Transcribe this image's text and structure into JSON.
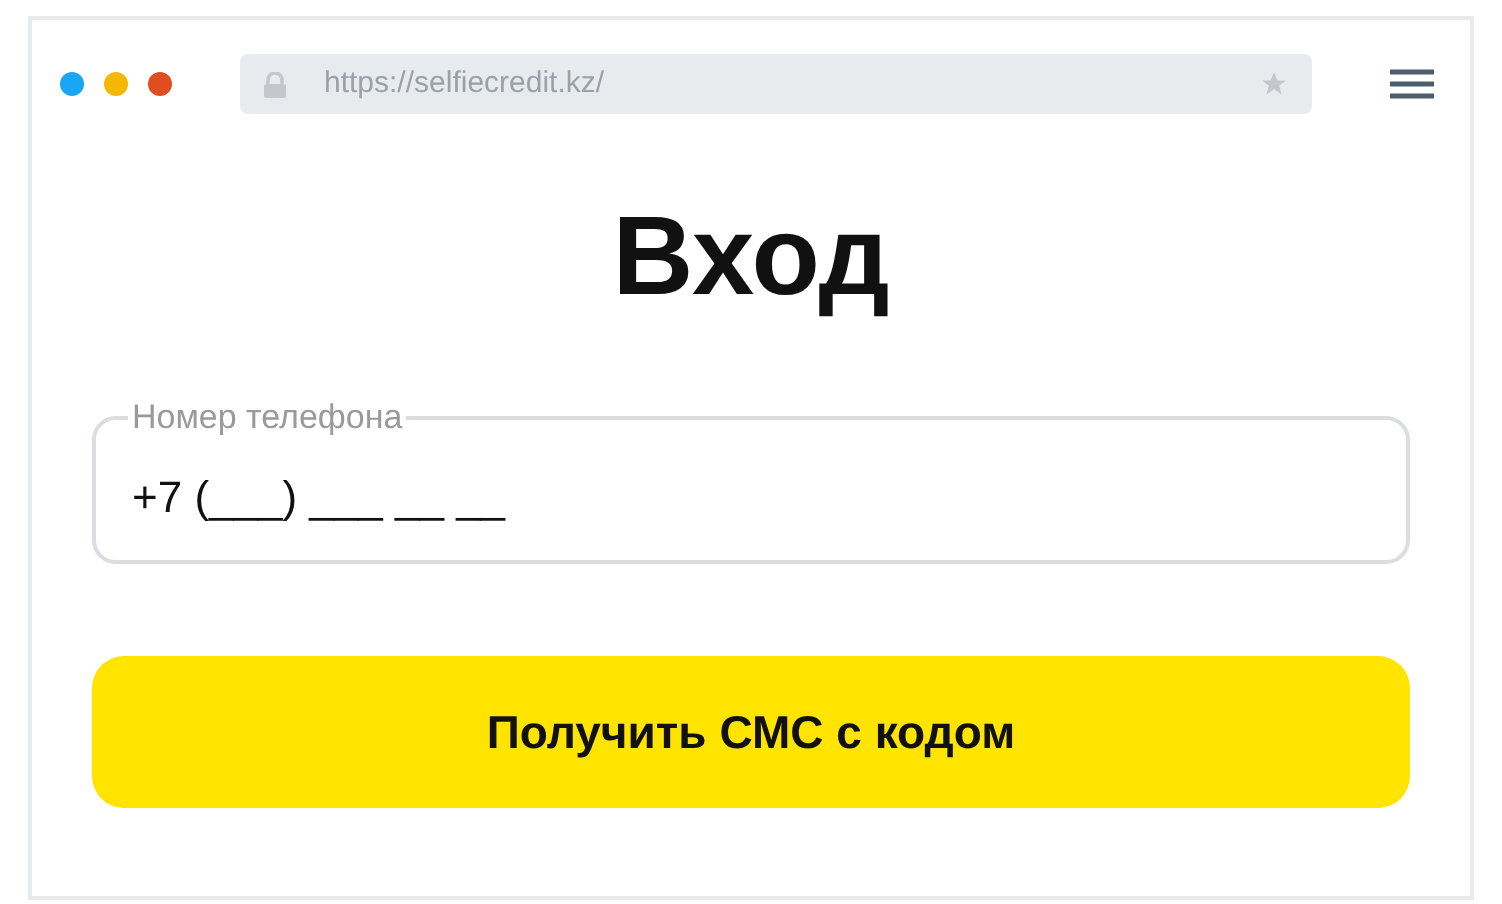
{
  "browser": {
    "window_dots": [
      {
        "color": "#1aa6f5"
      },
      {
        "color": "#f5b800"
      },
      {
        "color": "#e04e1f"
      }
    ],
    "url": "https://selfiecredit.kz/"
  },
  "title": "Вход",
  "phone_field": {
    "label": "Номер телефона",
    "value": "+7 (___) ___ __ __"
  },
  "submit_button": "Получить СМС с кодом"
}
